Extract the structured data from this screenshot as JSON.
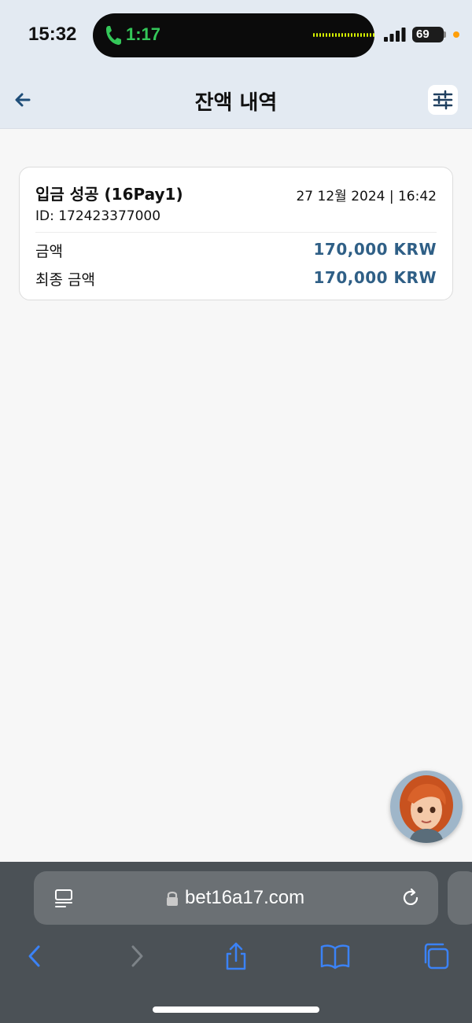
{
  "status_bar": {
    "time": "15:32",
    "call_duration": "1:17",
    "battery": "69"
  },
  "header": {
    "title": "잔액 내역",
    "back_icon": "arrow-left-icon",
    "filter_icon": "sliders-icon"
  },
  "transactions": [
    {
      "title": "입금 성공 (16Pay1)",
      "date": "27 12월 2024 | 16:42",
      "id": "ID: 172423377000",
      "amount_label": "금액",
      "amount_value": "170,000 KRW",
      "final_label": "최종 금액",
      "final_value": "170,000 KRW"
    }
  ],
  "browser": {
    "url": "bet16a17.com",
    "toolbar_icons": [
      "back-icon",
      "forward-icon",
      "share-icon",
      "bookmarks-icon",
      "tabs-icon"
    ]
  },
  "colors": {
    "accent": "#2f5f86",
    "header_bg": "#e3eaf2",
    "browser_bg": "#4b5156",
    "browser_icon": "#3b82f6"
  }
}
